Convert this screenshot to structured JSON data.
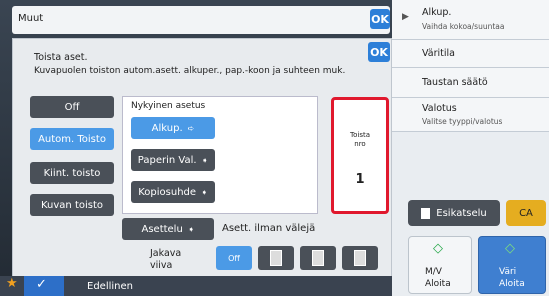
{
  "header": {
    "title": "Muut",
    "ok_label": "OK"
  },
  "dialog": {
    "title": "Toista aset.",
    "description": "Kuvapuolen toiston autom.asett. alkuper., pap.-koon ja suhteen muk.",
    "ok_label": "OK",
    "modes": [
      "Off",
      "Autom. Toisto",
      "Kiint. toisto",
      "Kuvan toisto"
    ],
    "current_label": "Nykyinen asetus",
    "buttons": {
      "original": "Alkup.",
      "paper": "Paperin Val.",
      "ratio": "Kopiosuhde"
    },
    "count_label_line1": "Toista",
    "count_label_line2": "nro",
    "count_value": "1",
    "layout_button": "Asettelu",
    "layout_value": "Asett. ilman välejä",
    "divider_line1": "Jakava",
    "divider_line2": "viiva",
    "divider_off": "Off"
  },
  "right_panel": {
    "items": [
      {
        "title": "Alkup.",
        "sub": "Vaihda kokoa/suuntaa"
      },
      {
        "title": "Väritila",
        "sub": ""
      },
      {
        "title": "Taustan säätö",
        "sub": ""
      },
      {
        "title": "Valotus",
        "sub": "Valitse tyyppi/valotus"
      }
    ],
    "preview": "Esikatselu",
    "ca": "CA",
    "mono_line1": "M/V",
    "mono_line2": "Aloita",
    "color_line1": "Väri",
    "color_line2": "Aloita"
  },
  "bottom": {
    "previous": "Edellinen"
  },
  "colors": {
    "accent": "#2d7fd8",
    "highlight": "#e0182d",
    "selected": "#4b9ae6"
  }
}
